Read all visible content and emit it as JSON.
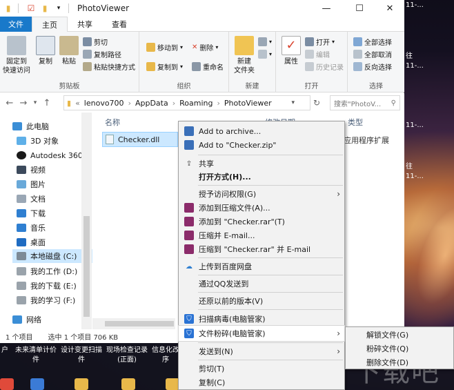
{
  "window": {
    "title": "PhotoViewer"
  },
  "ribbon": {
    "tabs": [
      {
        "label": "文件"
      },
      {
        "label": "主页"
      },
      {
        "label": "共享"
      },
      {
        "label": "查看"
      }
    ],
    "clipboard": {
      "pin": "固定到\n快速访问",
      "copy": "复制",
      "paste": "粘贴",
      "cut": "剪切",
      "copy_path": "复制路径",
      "paste_shortcut": "粘贴快捷方式",
      "label": "剪贴板"
    },
    "organize": {
      "move_to": "移动到",
      "copy_to": "复制到",
      "delete": "删除",
      "rename": "重命名",
      "label": "组织"
    },
    "new": {
      "new_folder": "新建\n文件夹",
      "label": "新建"
    },
    "open": {
      "properties": "属性",
      "open": "打开",
      "edit": "编辑",
      "history": "历史记录",
      "label": "打开"
    },
    "select": {
      "select_all": "全部选择",
      "select_none": "全部取消",
      "invert": "反向选择",
      "label": "选择"
    }
  },
  "address": {
    "prefix": "«",
    "crumbs": [
      "lenovo700",
      "AppData",
      "Roaming",
      "PhotoViewer"
    ],
    "search_placeholder": "搜索\"PhotoV..."
  },
  "nav": {
    "items": [
      {
        "label": "此电脑"
      },
      {
        "label": "3D 对象"
      },
      {
        "label": "Autodesk 360"
      },
      {
        "label": "视频"
      },
      {
        "label": "图片"
      },
      {
        "label": "文档"
      },
      {
        "label": "下载"
      },
      {
        "label": "音乐"
      },
      {
        "label": "桌面"
      },
      {
        "label": "本地磁盘 (C:)"
      },
      {
        "label": "我的工作 (D:)"
      },
      {
        "label": "我的下载 (E:)"
      },
      {
        "label": "我的学习 (F:)"
      },
      {
        "label": "网络"
      }
    ]
  },
  "content": {
    "columns": {
      "name": "名称",
      "date": "修改日期",
      "type": "类型"
    },
    "files": [
      {
        "name": "Checker.dll",
        "type": "应用程序扩展"
      }
    ]
  },
  "status": {
    "count": "1 个项目",
    "selected": "选中 1 个项目  706 KB"
  },
  "context_menu": {
    "items": [
      "Add to archive...",
      "Add to \"Checker.zip\"",
      "共享",
      "打开方式(H)...",
      "授予访问权限(G)",
      "添加到压缩文件(A)...",
      "添加到 \"Checker.rar\"(T)",
      "压缩并 E-mail...",
      "压缩到 \"Checker.rar\" 并 E-mail",
      "上传到百度网盘",
      "通过QQ发送到",
      "还原以前的版本(V)",
      "扫描病毒(电脑管家)",
      "文件粉碎(电脑管家)",
      "发送到(N)",
      "剪切(T)",
      "复制(C)"
    ]
  },
  "submenu": {
    "items": [
      "解锁文件(G)",
      "粉碎文件(Q)",
      "删除文件(D)"
    ]
  },
  "taskbar_labels": [
    "户",
    "未来清单计价\n件",
    "设计变更扫描\n件",
    "现场检查记录\n(正面)",
    "信息化改\n序"
  ],
  "desktop_labels": [
    "11-...",
    "往",
    "11-...",
    "11-...",
    "往",
    "11-..."
  ],
  "watermark": "下载吧"
}
